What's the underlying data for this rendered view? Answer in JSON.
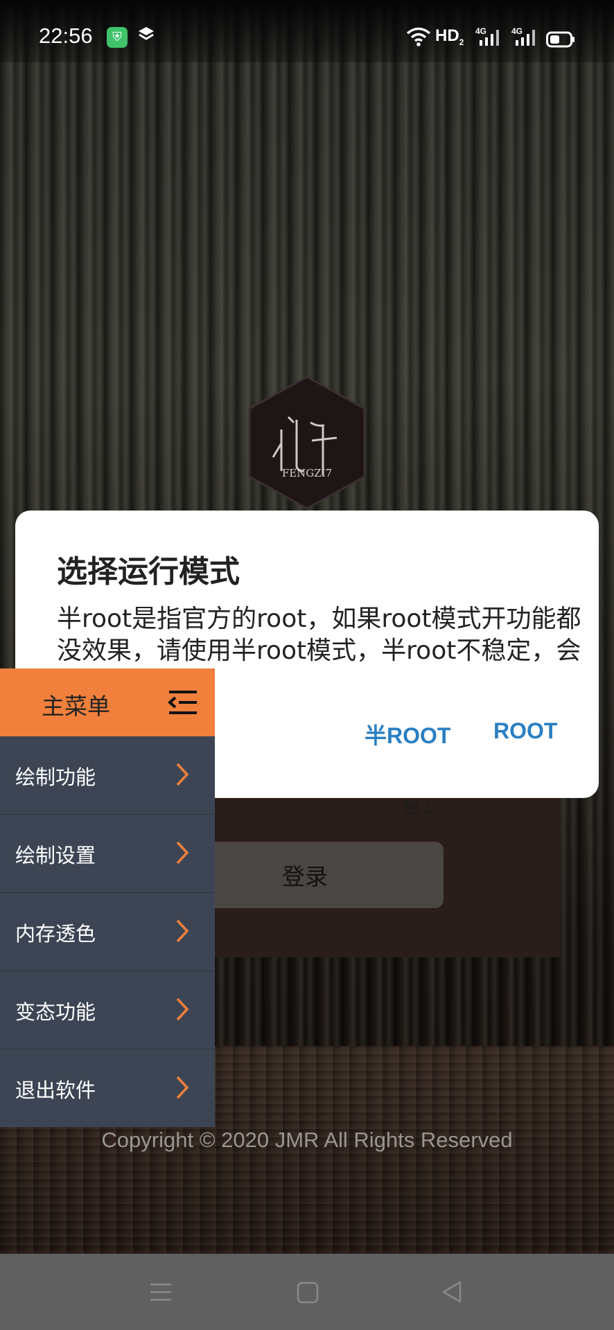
{
  "status_bar": {
    "time": "22:56",
    "network_label": "HD",
    "network_sub": "2",
    "signal1_label": "4G",
    "signal2_label": "4G",
    "icons": [
      "shield-app-icon",
      "layers-icon",
      "wifi-icon",
      "signal-icon",
      "signal-icon",
      "battery-icon"
    ]
  },
  "logo": {
    "text": "FENGZI7"
  },
  "login": {
    "button_label": "登录",
    "fragment_text": "7 码"
  },
  "copyright": "Copyright © 2020 JMR All Rights Reserved",
  "dialog": {
    "title": "选择运行模式",
    "message": "半root是指官方的root，如果root模式开功能都没效果，请使用半root模式，半root不稳定，会微卡！",
    "half_root_button": "半ROOT",
    "root_button": "ROOT"
  },
  "menu": {
    "title": "主菜单",
    "items": [
      {
        "label": "绘制功能"
      },
      {
        "label": "绘制设置"
      },
      {
        "label": "内存透色"
      },
      {
        "label": "变态功能"
      },
      {
        "label": "退出软件"
      }
    ]
  },
  "colors": {
    "menu_header": "#f0803c",
    "menu_body": "#3d4554",
    "chevron": "#f0803c",
    "dialog_button": "#2a7fc2"
  }
}
